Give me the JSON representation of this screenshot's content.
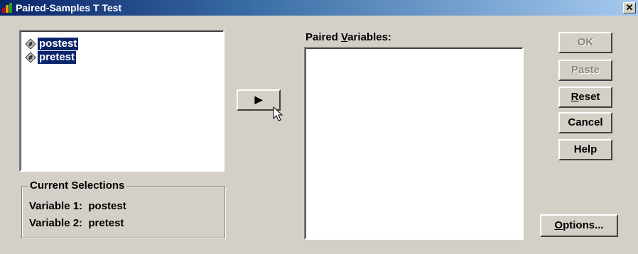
{
  "window": {
    "title": "Paired-Samples T Test",
    "close_glyph": "✕"
  },
  "source_list": {
    "items": [
      {
        "label": "postest",
        "icon": "numeric-variable-icon"
      },
      {
        "label": "pretest",
        "icon": "numeric-variable-icon"
      }
    ]
  },
  "move_button": {
    "glyph": "▶"
  },
  "paired": {
    "label_prefix": "Paired ",
    "label_mnemonic": "V",
    "label_suffix": "ariables:"
  },
  "buttons": {
    "ok": {
      "label": "OK",
      "enabled": false
    },
    "paste": {
      "mnemonic": "P",
      "rest": "aste",
      "enabled": false
    },
    "reset": {
      "mnemonic": "R",
      "rest": "eset",
      "enabled": true
    },
    "cancel": {
      "label": "Cancel",
      "enabled": true
    },
    "help": {
      "label": "Help",
      "enabled": true
    },
    "options": {
      "mnemonic": "O",
      "rest": "ptions...",
      "enabled": true
    }
  },
  "current_selections": {
    "title": "Current Selections",
    "variable1_label": "Variable 1:",
    "variable1_value": "postest",
    "variable2_label": "Variable 2:",
    "variable2_value": "pretest"
  }
}
